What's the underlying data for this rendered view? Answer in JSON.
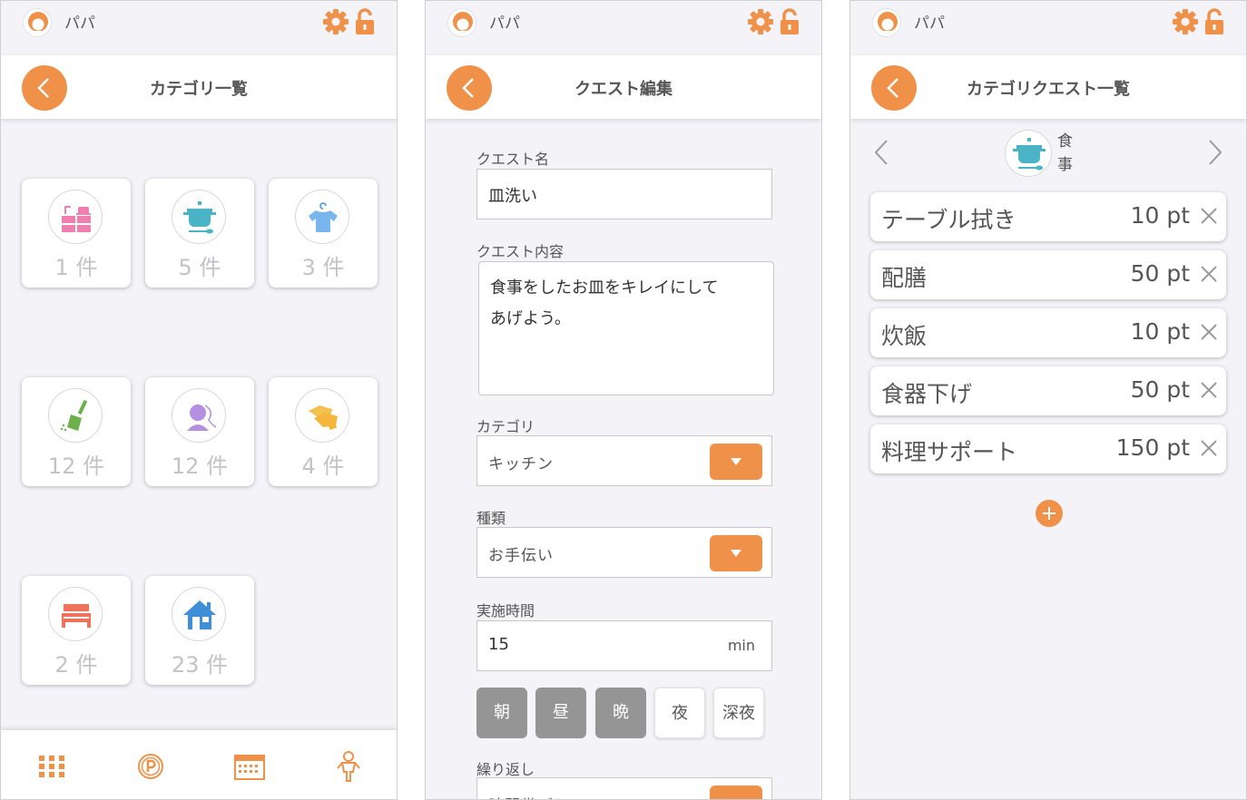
{
  "user": {
    "name": "パパ"
  },
  "colors": {
    "accent": "#f0914a",
    "background": "#f4f3f8",
    "count_text": "#c2c2c8"
  },
  "screen1": {
    "title": "カテゴリ一覧",
    "categories": [
      {
        "icon": "kitchen-icon",
        "count": "1 件"
      },
      {
        "icon": "cooking-pot-icon",
        "count": "5 件"
      },
      {
        "icon": "laundry-shirt-icon",
        "count": "3 件"
      },
      {
        "icon": "broom-icon",
        "count": "12 件"
      },
      {
        "icon": "person-head-icon",
        "count": "12 件"
      },
      {
        "icon": "gloves-icon",
        "count": "4 件"
      },
      {
        "icon": "bed-icon",
        "count": "2 件"
      },
      {
        "icon": "house-icon",
        "count": "23 件"
      }
    ],
    "tabs": [
      "grid-icon",
      "points-icon",
      "calendar-icon",
      "child-icon"
    ]
  },
  "screen2": {
    "title": "クエスト編集",
    "quest_name_label": "クエスト名",
    "quest_name_value": "皿洗い",
    "quest_content_label": "クエスト内容",
    "quest_content_line1": "食事をしたお皿をキレイにして",
    "quest_content_line2": "あげよう。",
    "category_label": "カテゴリ",
    "category_value": "キッチン",
    "type_label": "種類",
    "type_value": "お手伝い",
    "duration_label": "実施時間",
    "duration_value": "15",
    "duration_unit": "min",
    "times": [
      {
        "label": "朝",
        "selected": true
      },
      {
        "label": "昼",
        "selected": true
      },
      {
        "label": "晩",
        "selected": true
      },
      {
        "label": "夜",
        "selected": false
      },
      {
        "label": "深夜",
        "selected": false
      }
    ],
    "repeat_label": "繰り返し",
    "repeat_value": "時間帯ごと"
  },
  "screen3": {
    "title": "カテゴリクエスト一覧",
    "category_name": "食事",
    "category_char1": "食",
    "category_char2": "事",
    "quests": [
      {
        "name": "テーブル拭き",
        "points": "10 pt"
      },
      {
        "name": "配膳",
        "points": "50 pt"
      },
      {
        "name": "炊飯",
        "points": "10 pt"
      },
      {
        "name": "食器下げ",
        "points": "50 pt"
      },
      {
        "name": "料理サポート",
        "points": "150 pt"
      }
    ]
  }
}
